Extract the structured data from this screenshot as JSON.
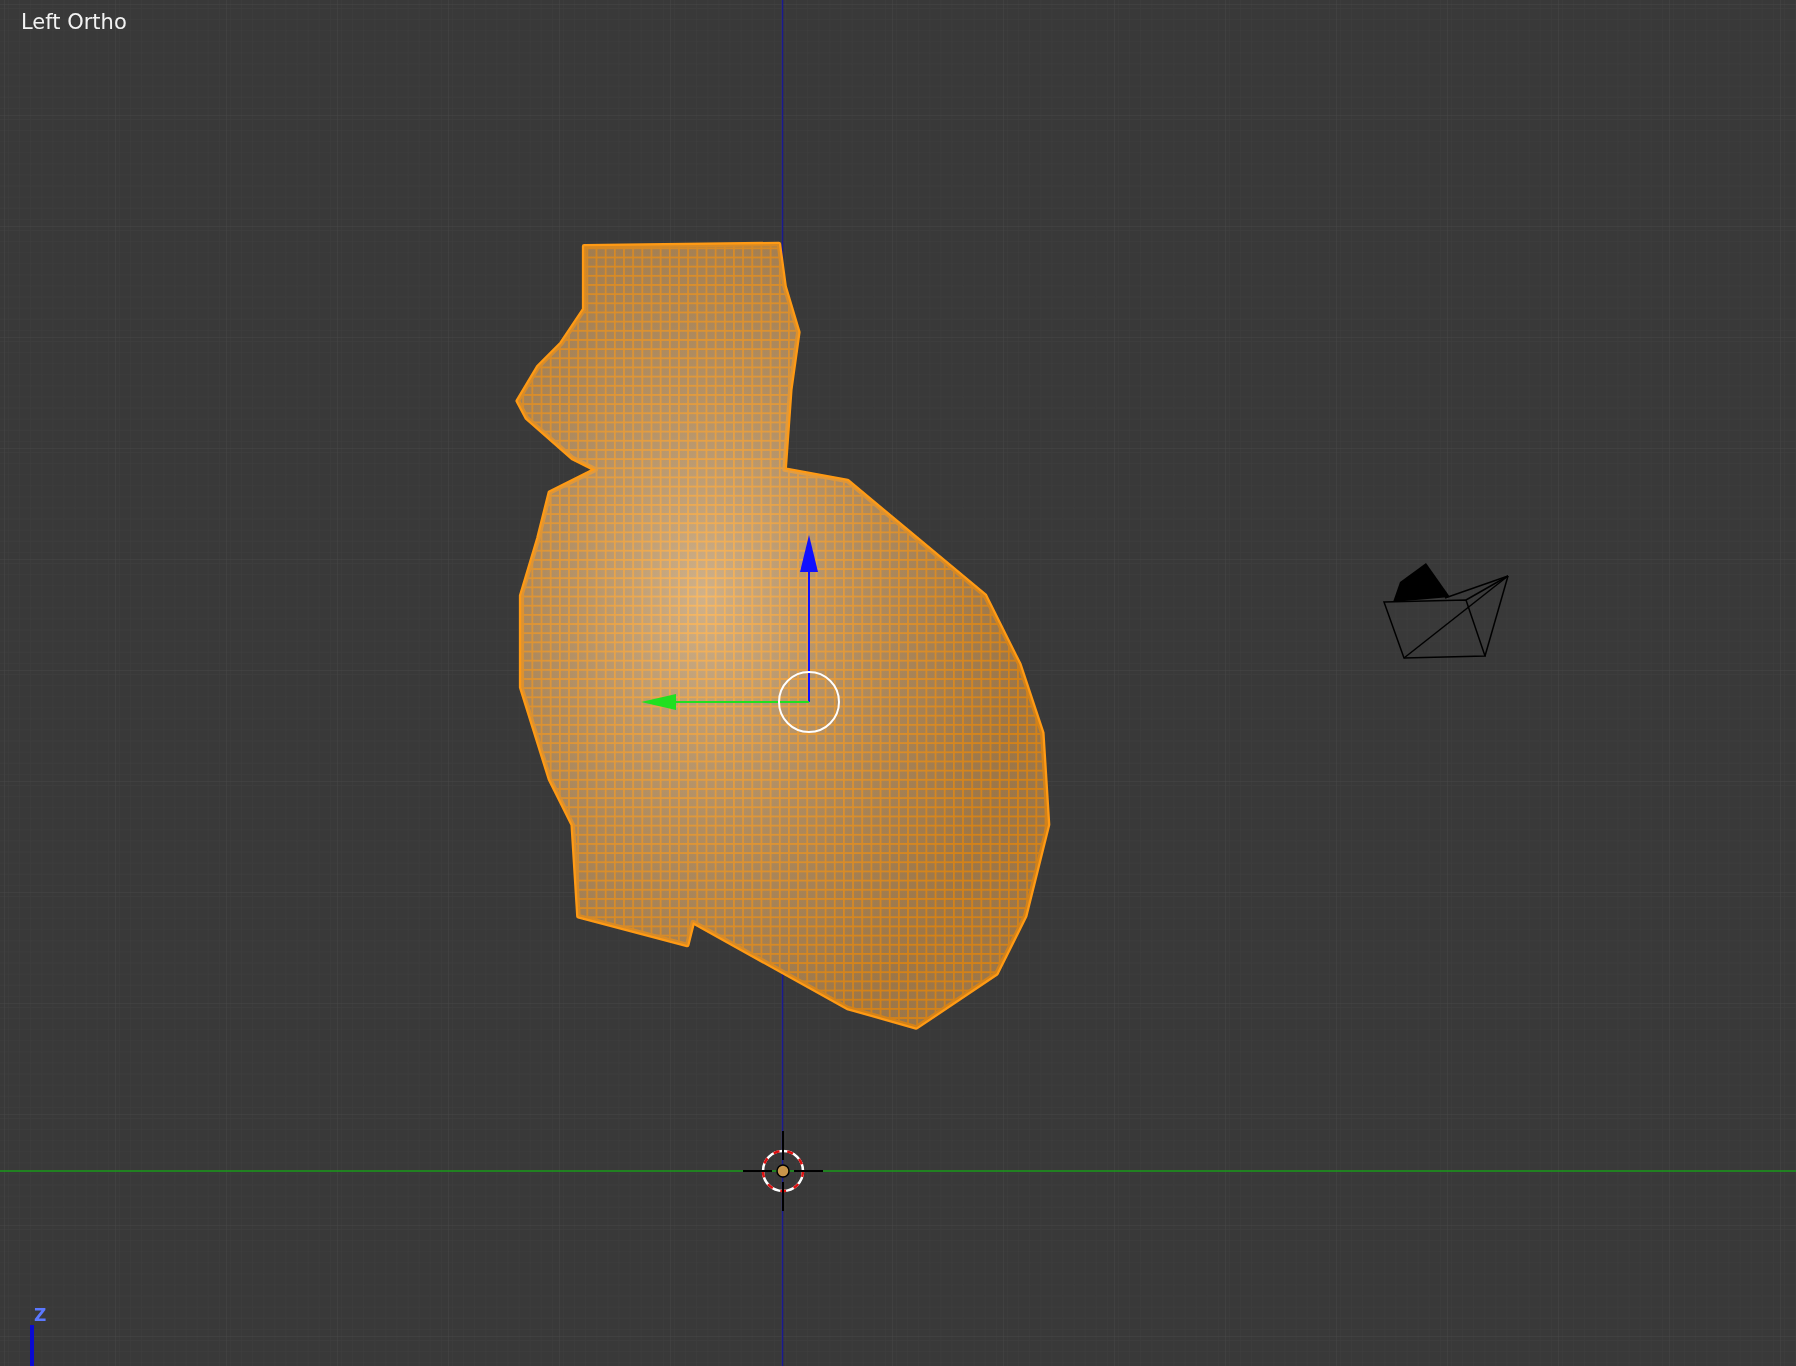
{
  "viewport": {
    "view_label": "Left Ortho",
    "axis_label": "Z"
  }
}
